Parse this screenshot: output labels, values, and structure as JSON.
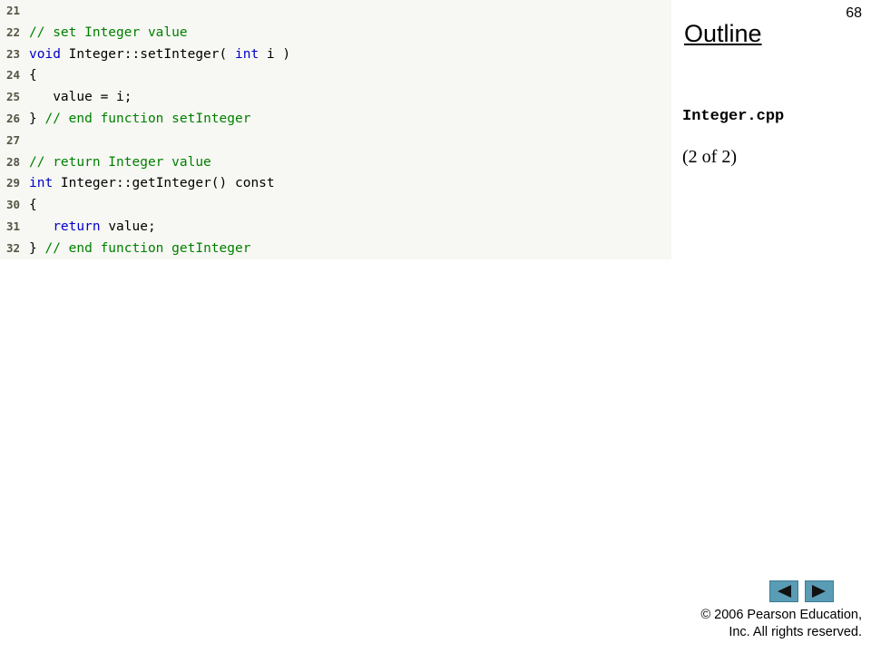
{
  "slide": {
    "number": "68",
    "outline_title": "Outline",
    "file_name": "Integer.cpp",
    "page_part": "(2 of 2)"
  },
  "code": [
    {
      "ln": "21",
      "segments": []
    },
    {
      "ln": "22",
      "segments": [
        {
          "t": "// set Integer value",
          "c": "comment"
        }
      ]
    },
    {
      "ln": "23",
      "segments": [
        {
          "t": "void",
          "c": "keyword"
        },
        {
          "t": " Integer::setInteger( ",
          "c": "code"
        },
        {
          "t": "int",
          "c": "keyword"
        },
        {
          "t": " i )",
          "c": "code"
        }
      ]
    },
    {
      "ln": "24",
      "segments": [
        {
          "t": "{",
          "c": "code"
        }
      ]
    },
    {
      "ln": "25",
      "segments": [
        {
          "t": "   value = i;",
          "c": "code"
        }
      ]
    },
    {
      "ln": "26",
      "segments": [
        {
          "t": "} ",
          "c": "code"
        },
        {
          "t": "// end function setInteger",
          "c": "comment"
        }
      ]
    },
    {
      "ln": "27",
      "segments": []
    },
    {
      "ln": "28",
      "segments": [
        {
          "t": "// return Integer value",
          "c": "comment"
        }
      ]
    },
    {
      "ln": "29",
      "segments": [
        {
          "t": "int",
          "c": "keyword"
        },
        {
          "t": " Integer::getInteger() const",
          "c": "code"
        }
      ]
    },
    {
      "ln": "30",
      "segments": [
        {
          "t": "{",
          "c": "code"
        }
      ]
    },
    {
      "ln": "31",
      "segments": [
        {
          "t": "   ",
          "c": "code"
        },
        {
          "t": "return",
          "c": "keyword"
        },
        {
          "t": " value;",
          "c": "code"
        }
      ]
    },
    {
      "ln": "32",
      "segments": [
        {
          "t": "} ",
          "c": "code"
        },
        {
          "t": "// end function getInteger",
          "c": "comment"
        }
      ]
    }
  ],
  "nav": {
    "prev_icon": "triangle-left-icon",
    "next_icon": "triangle-right-icon"
  },
  "copyright": {
    "line1": "© 2006 Pearson Education,",
    "line2": "Inc.  All rights reserved."
  },
  "colors": {
    "code_background": "#f7f7f3",
    "comment": "#008000",
    "keyword": "#0000cc",
    "nav_button": "#5a9cb5"
  }
}
